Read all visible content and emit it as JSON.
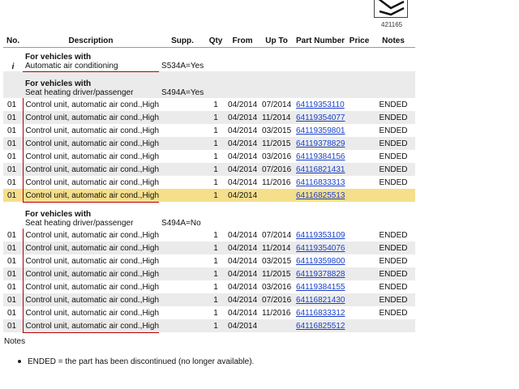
{
  "diagram": {
    "number": "421165"
  },
  "table": {
    "headers": {
      "no": "No.",
      "description": "Description",
      "supp": "Supp.",
      "qty": "Qty",
      "from": "From",
      "upto": "Up To",
      "part": "Part Number",
      "price": "Price",
      "notes": "Notes"
    },
    "group0": {
      "no": "i",
      "title": "For vehicles with",
      "subtitle": "Automatic air conditioning",
      "supp": "S534A=Yes"
    },
    "group1": {
      "title": "For vehicles with",
      "subtitle": "Seat heating driver/passenger",
      "supp": "S494A=Yes",
      "rows": [
        {
          "no": "01",
          "desc": "Control unit, automatic air cond.,High",
          "qty": "1",
          "from": "04/2014",
          "upto": "07/2014",
          "part": "64119353110",
          "notes": "ENDED"
        },
        {
          "no": "01",
          "desc": "Control unit, automatic air cond.,High",
          "qty": "1",
          "from": "04/2014",
          "upto": "11/2014",
          "part": "64119354077",
          "notes": "ENDED"
        },
        {
          "no": "01",
          "desc": "Control unit, automatic air cond.,High",
          "qty": "1",
          "from": "04/2014",
          "upto": "03/2015",
          "part": "64119359801",
          "notes": "ENDED"
        },
        {
          "no": "01",
          "desc": "Control unit, automatic air cond.,High",
          "qty": "1",
          "from": "04/2014",
          "upto": "11/2015",
          "part": "64119378829",
          "notes": "ENDED"
        },
        {
          "no": "01",
          "desc": "Control unit, automatic air cond.,High",
          "qty": "1",
          "from": "04/2014",
          "upto": "03/2016",
          "part": "64119384156",
          "notes": "ENDED"
        },
        {
          "no": "01",
          "desc": "Control unit, automatic air cond.,High",
          "qty": "1",
          "from": "04/2014",
          "upto": "07/2016",
          "part": "64116821431",
          "notes": "ENDED"
        },
        {
          "no": "01",
          "desc": "Control unit, automatic air cond.,High",
          "qty": "1",
          "from": "04/2014",
          "upto": "11/2016",
          "part": "64116833313",
          "notes": "ENDED"
        },
        {
          "no": "01",
          "desc": "Control unit, automatic air cond.,High",
          "qty": "1",
          "from": "04/2014",
          "upto": "",
          "part": "64116825513",
          "notes": ""
        }
      ]
    },
    "group2": {
      "title": "For vehicles with",
      "subtitle": "Seat heating driver/passenger",
      "supp": "S494A=No",
      "rows": [
        {
          "no": "01",
          "desc": "Control unit, automatic air cond.,High",
          "qty": "1",
          "from": "04/2014",
          "upto": "07/2014",
          "part": "64119353109",
          "notes": "ENDED"
        },
        {
          "no": "01",
          "desc": "Control unit, automatic air cond.,High",
          "qty": "1",
          "from": "04/2014",
          "upto": "11/2014",
          "part": "64119354076",
          "notes": "ENDED"
        },
        {
          "no": "01",
          "desc": "Control unit, automatic air cond.,High",
          "qty": "1",
          "from": "04/2014",
          "upto": "03/2015",
          "part": "64119359800",
          "notes": "ENDED"
        },
        {
          "no": "01",
          "desc": "Control unit, automatic air cond.,High",
          "qty": "1",
          "from": "04/2014",
          "upto": "11/2015",
          "part": "64119378828",
          "notes": "ENDED"
        },
        {
          "no": "01",
          "desc": "Control unit, automatic air cond.,High",
          "qty": "1",
          "from": "04/2014",
          "upto": "03/2016",
          "part": "64119384155",
          "notes": "ENDED"
        },
        {
          "no": "01",
          "desc": "Control unit, automatic air cond.,High",
          "qty": "1",
          "from": "04/2014",
          "upto": "07/2016",
          "part": "64116821430",
          "notes": "ENDED"
        },
        {
          "no": "01",
          "desc": "Control unit, automatic air cond.,High",
          "qty": "1",
          "from": "04/2014",
          "upto": "11/2016",
          "part": "64116833312",
          "notes": "ENDED"
        },
        {
          "no": "01",
          "desc": "Control unit, automatic air cond.,High",
          "qty": "1",
          "from": "04/2014",
          "upto": "",
          "part": "64116825512",
          "notes": ""
        }
      ]
    }
  },
  "notes": {
    "title": "Notes",
    "items": [
      "ENDED = the part has been discontinued (no longer available)."
    ]
  }
}
